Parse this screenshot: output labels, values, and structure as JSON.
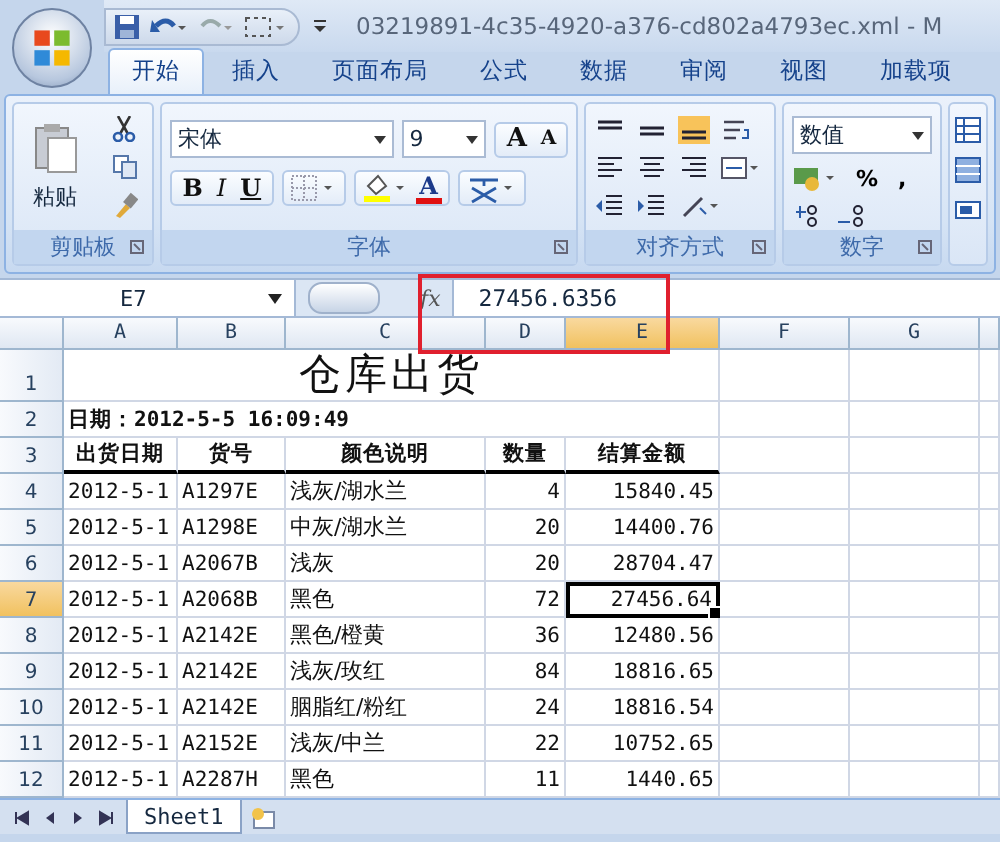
{
  "window": {
    "title": "03219891-4c35-4920-a376-cd802a4793ec.xml - M"
  },
  "tabs": [
    {
      "label": "开始",
      "selected": true
    },
    {
      "label": "插入",
      "selected": false
    },
    {
      "label": "页面布局",
      "selected": false
    },
    {
      "label": "公式",
      "selected": false
    },
    {
      "label": "数据",
      "selected": false
    },
    {
      "label": "审阅",
      "selected": false
    },
    {
      "label": "视图",
      "selected": false
    },
    {
      "label": "加载项",
      "selected": false
    }
  ],
  "ribbon": {
    "clipboard": {
      "paste_label": "粘贴",
      "group_label": "剪贴板"
    },
    "font": {
      "font_name": "宋体",
      "font_size": "9",
      "grow_label": "A",
      "shrink_label": "A",
      "bold_label": "B",
      "italic_label": "I",
      "underline_label": "U",
      "font_color_label": "A",
      "group_label": "字体"
    },
    "alignment": {
      "group_label": "对齐方式"
    },
    "number": {
      "format": "数值",
      "percent_label": "%",
      "comma_label": ",",
      "group_label": "数字"
    }
  },
  "formula_bar": {
    "name_box": "E7",
    "function_label": "fx",
    "formula": "27456.6356"
  },
  "sheet": {
    "columns": [
      {
        "label": "A",
        "selected": false
      },
      {
        "label": "B",
        "selected": false
      },
      {
        "label": "C",
        "selected": false
      },
      {
        "label": "D",
        "selected": false
      },
      {
        "label": "E",
        "selected": true
      },
      {
        "label": "F",
        "selected": false
      },
      {
        "label": "G",
        "selected": false
      }
    ],
    "rows": [
      {
        "number": "1",
        "selected": false,
        "kind": "title",
        "text": "仓库出货"
      },
      {
        "number": "2",
        "selected": false,
        "kind": "date",
        "text": "日期：2012-5-5 16:09:49"
      },
      {
        "number": "3",
        "selected": false,
        "kind": "header",
        "cells": [
          {
            "text": "出货日期",
            "selected": false
          },
          {
            "text": "货号",
            "selected": false
          },
          {
            "text": "颜色说明",
            "selected": false
          },
          {
            "text": "数量",
            "selected": false
          },
          {
            "text": "结算金额",
            "selected": false
          }
        ]
      },
      {
        "number": "4",
        "selected": false,
        "kind": "data",
        "cells": [
          {
            "text": "2012-5-1",
            "selected": false
          },
          {
            "text": "A1297E",
            "selected": false
          },
          {
            "text": "浅灰/湖水兰",
            "selected": false
          },
          {
            "text": "4",
            "selected": false
          },
          {
            "text": "15840.45",
            "selected": false
          }
        ]
      },
      {
        "number": "5",
        "selected": false,
        "kind": "data",
        "cells": [
          {
            "text": "2012-5-1",
            "selected": false
          },
          {
            "text": "A1298E",
            "selected": false
          },
          {
            "text": "中灰/湖水兰",
            "selected": false
          },
          {
            "text": "20",
            "selected": false
          },
          {
            "text": "14400.76",
            "selected": false
          }
        ]
      },
      {
        "number": "6",
        "selected": false,
        "kind": "data",
        "cells": [
          {
            "text": "2012-5-1",
            "selected": false
          },
          {
            "text": "A2067B",
            "selected": false
          },
          {
            "text": "浅灰",
            "selected": false
          },
          {
            "text": "20",
            "selected": false
          },
          {
            "text": "28704.47",
            "selected": false
          }
        ]
      },
      {
        "number": "7",
        "selected": true,
        "kind": "data",
        "cells": [
          {
            "text": "2012-5-1",
            "selected": false
          },
          {
            "text": "A2068B",
            "selected": false
          },
          {
            "text": "黑色",
            "selected": false
          },
          {
            "text": "72",
            "selected": false
          },
          {
            "text": "27456.64",
            "selected": true
          }
        ]
      },
      {
        "number": "8",
        "selected": false,
        "kind": "data",
        "cells": [
          {
            "text": "2012-5-1",
            "selected": false
          },
          {
            "text": "A2142E",
            "selected": false
          },
          {
            "text": "黑色/橙黄",
            "selected": false
          },
          {
            "text": "36",
            "selected": false
          },
          {
            "text": "12480.56",
            "selected": false
          }
        ]
      },
      {
        "number": "9",
        "selected": false,
        "kind": "data",
        "cells": [
          {
            "text": "2012-5-1",
            "selected": false
          },
          {
            "text": "A2142E",
            "selected": false
          },
          {
            "text": "浅灰/玫红",
            "selected": false
          },
          {
            "text": "84",
            "selected": false
          },
          {
            "text": "18816.65",
            "selected": false
          }
        ]
      },
      {
        "number": "10",
        "selected": false,
        "kind": "data",
        "cells": [
          {
            "text": "2012-5-1",
            "selected": false
          },
          {
            "text": "A2142E",
            "selected": false
          },
          {
            "text": "胭脂红/粉红",
            "selected": false
          },
          {
            "text": "24",
            "selected": false
          },
          {
            "text": "18816.54",
            "selected": false
          }
        ]
      },
      {
        "number": "11",
        "selected": false,
        "kind": "data",
        "cells": [
          {
            "text": "2012-5-1",
            "selected": false
          },
          {
            "text": "A2152E",
            "selected": false
          },
          {
            "text": "浅灰/中兰",
            "selected": false
          },
          {
            "text": "22",
            "selected": false
          },
          {
            "text": "10752.65",
            "selected": false
          }
        ]
      },
      {
        "number": "12",
        "selected": false,
        "kind": "data",
        "cells": [
          {
            "text": "2012-5-1",
            "selected": false
          },
          {
            "text": "A2287H",
            "selected": false
          },
          {
            "text": "黑色",
            "selected": false
          },
          {
            "text": "11",
            "selected": false
          },
          {
            "text": "1440.65",
            "selected": false
          }
        ]
      }
    ]
  },
  "sheet_tabs": [
    {
      "label": "Sheet1",
      "selected": true
    }
  ]
}
